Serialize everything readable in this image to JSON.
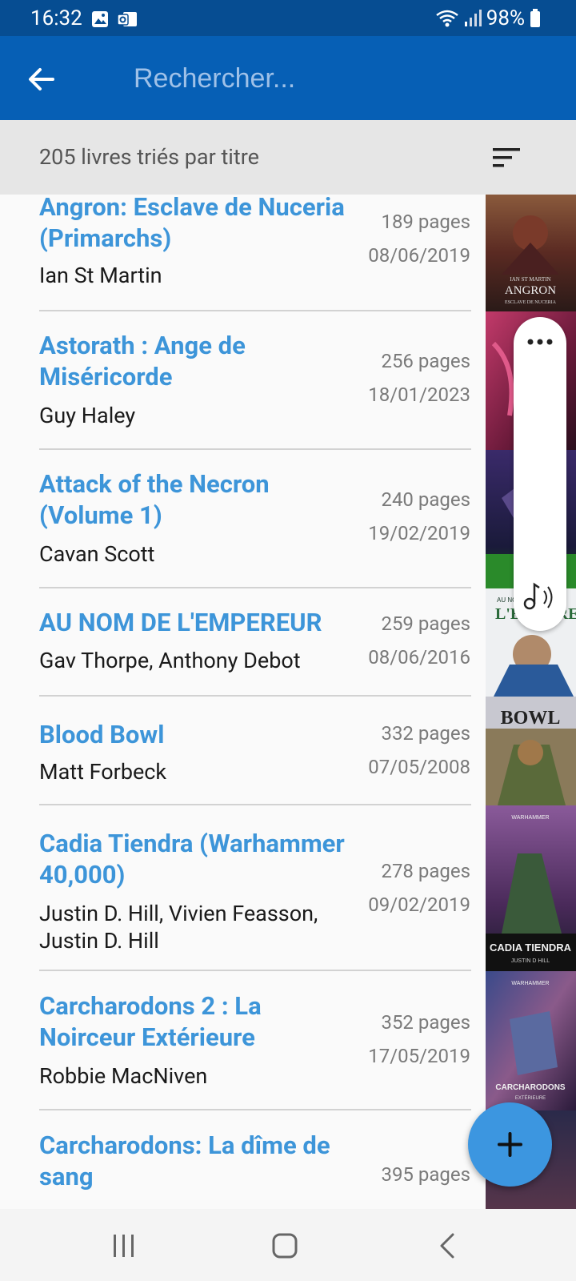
{
  "status_bar": {
    "time": "16:32",
    "battery": "98%"
  },
  "app_bar": {
    "search_placeholder": "Rechercher..."
  },
  "sort_bar": {
    "summary": "205 livres triés par titre"
  },
  "books": [
    {
      "title": "Angron: Esclave de Nuceria (Primarchs)",
      "author": "Ian St Martin",
      "pages": "189 pages",
      "date": "08/06/2019"
    },
    {
      "title": "Astorath : Ange de Miséricorde",
      "author": "Guy Haley",
      "pages": "256 pages",
      "date": "18/01/2023"
    },
    {
      "title": "Attack of the Necron (Volume 1)",
      "author": "Cavan Scott",
      "pages": "240 pages",
      "date": "19/02/2019"
    },
    {
      "title": "AU NOM DE L'EMPEREUR",
      "author": "Gav Thorpe, Anthony Debot",
      "pages": "259 pages",
      "date": "08/06/2016"
    },
    {
      "title": "Blood Bowl",
      "author": "Matt Forbeck",
      "pages": "332 pages",
      "date": "07/05/2008"
    },
    {
      "title": "Cadia Tiendra (Warhammer 40,000)",
      "author": "Justin D. Hill, Vivien Feasson, Justin D. Hill",
      "pages": "278 pages",
      "date": "09/02/2019"
    },
    {
      "title": "Carcharodons 2 : La Noirceur Extérieure",
      "author": "Robbie MacNiven",
      "pages": "352 pages",
      "date": "17/05/2019"
    },
    {
      "title": "Carcharodons: La dîme de sang",
      "author": "",
      "pages": "395 pages",
      "date": ""
    }
  ],
  "covers": {
    "angron_line1": "IAN ST MARTIN",
    "angron_line2": "ANGRON",
    "angron_line3": "ESCLAVE DE NUCERIA",
    "empereur_line1": "AU NOM DE",
    "empereur_line2": "L'EMPEREUR",
    "bloodbowl": "BOWL",
    "cadia_title": "CADIA TIENDRA",
    "cadia_author": "JUSTIN D HILL",
    "carcha_brand": "WARHAMMER",
    "carcha_title": "CARCHARODONS",
    "carcha_sub": "EXTÉRIEURE"
  },
  "icons": [
    "back-arrow-icon",
    "sort-icon",
    "more-icon",
    "audio-icon",
    "add-icon",
    "recent-apps-icon",
    "home-icon",
    "back-icon"
  ]
}
